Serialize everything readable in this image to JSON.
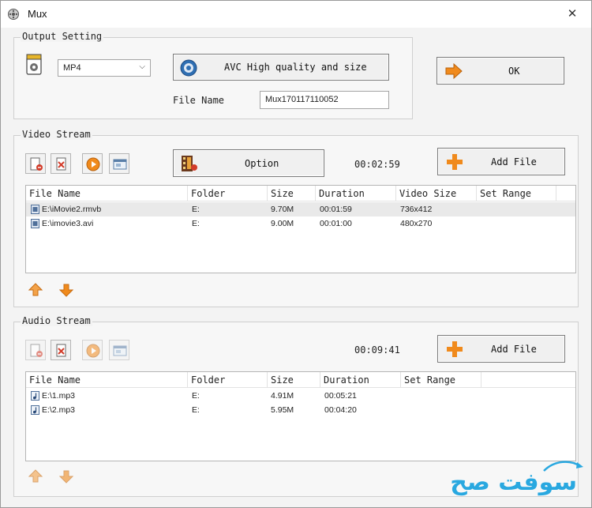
{
  "window": {
    "title": "Mux",
    "close_glyph": "✕"
  },
  "output": {
    "group_label": "Output Setting",
    "format_value": "MP4",
    "profile_label": "AVC High quality and size",
    "filename_label": "File Name",
    "filename_value": "Mux170117110052",
    "ok_label": "OK"
  },
  "video": {
    "group_label": "Video Stream",
    "option_label": "Option",
    "duration": "00:02:59",
    "add_file_label": "Add File",
    "columns": [
      "File Name",
      "Folder",
      "Size",
      "Duration",
      "Video Size",
      "Set Range"
    ],
    "rows": [
      {
        "name": "E:\\iMovie2.rmvb",
        "folder": "E:",
        "size": "9.70M",
        "duration": "00:01:59",
        "video_size": "736x412",
        "range": ""
      },
      {
        "name": "E:\\imovie3.avi",
        "folder": "E:",
        "size": "9.00M",
        "duration": "00:01:00",
        "video_size": "480x270",
        "range": ""
      }
    ]
  },
  "audio": {
    "group_label": "Audio Stream",
    "duration": "00:09:41",
    "add_file_label": "Add File",
    "columns": [
      "File Name",
      "Folder",
      "Size",
      "Duration",
      "Set Range"
    ],
    "rows": [
      {
        "name": "E:\\1.mp3",
        "folder": "E:",
        "size": "4.91M",
        "duration": "00:05:21",
        "range": ""
      },
      {
        "name": "E:\\2.mp3",
        "folder": "E:",
        "size": "5.95M",
        "duration": "00:04:20",
        "range": ""
      }
    ]
  },
  "watermark": {
    "text": "سوفت صح"
  },
  "colors": {
    "accent_orange": "#f08a1c",
    "watermark_blue": "#29a8e0"
  }
}
